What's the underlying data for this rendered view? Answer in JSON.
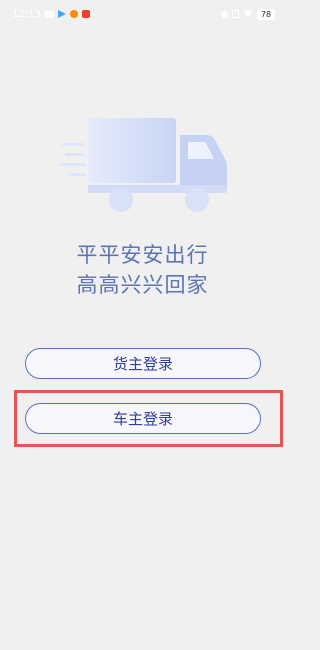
{
  "status_bar": {
    "time": "12:13",
    "battery": "78"
  },
  "hero": {
    "icon": "truck-icon",
    "colors": {
      "cargo": "#cfd9f6",
      "cab": "#c2d0f2",
      "wheel": "#d4ddf7"
    }
  },
  "slogan": {
    "line1": "平平安安出行",
    "line2": "高高兴兴回家"
  },
  "buttons": {
    "shipper_login": "货主登录",
    "driver_login": "车主登录"
  },
  "colors": {
    "background": "#f0f0f0",
    "slogan": "#5c74b3",
    "button_border": "#5a6fc4",
    "button_text": "#2f3f9c",
    "highlight": "#e85557"
  }
}
